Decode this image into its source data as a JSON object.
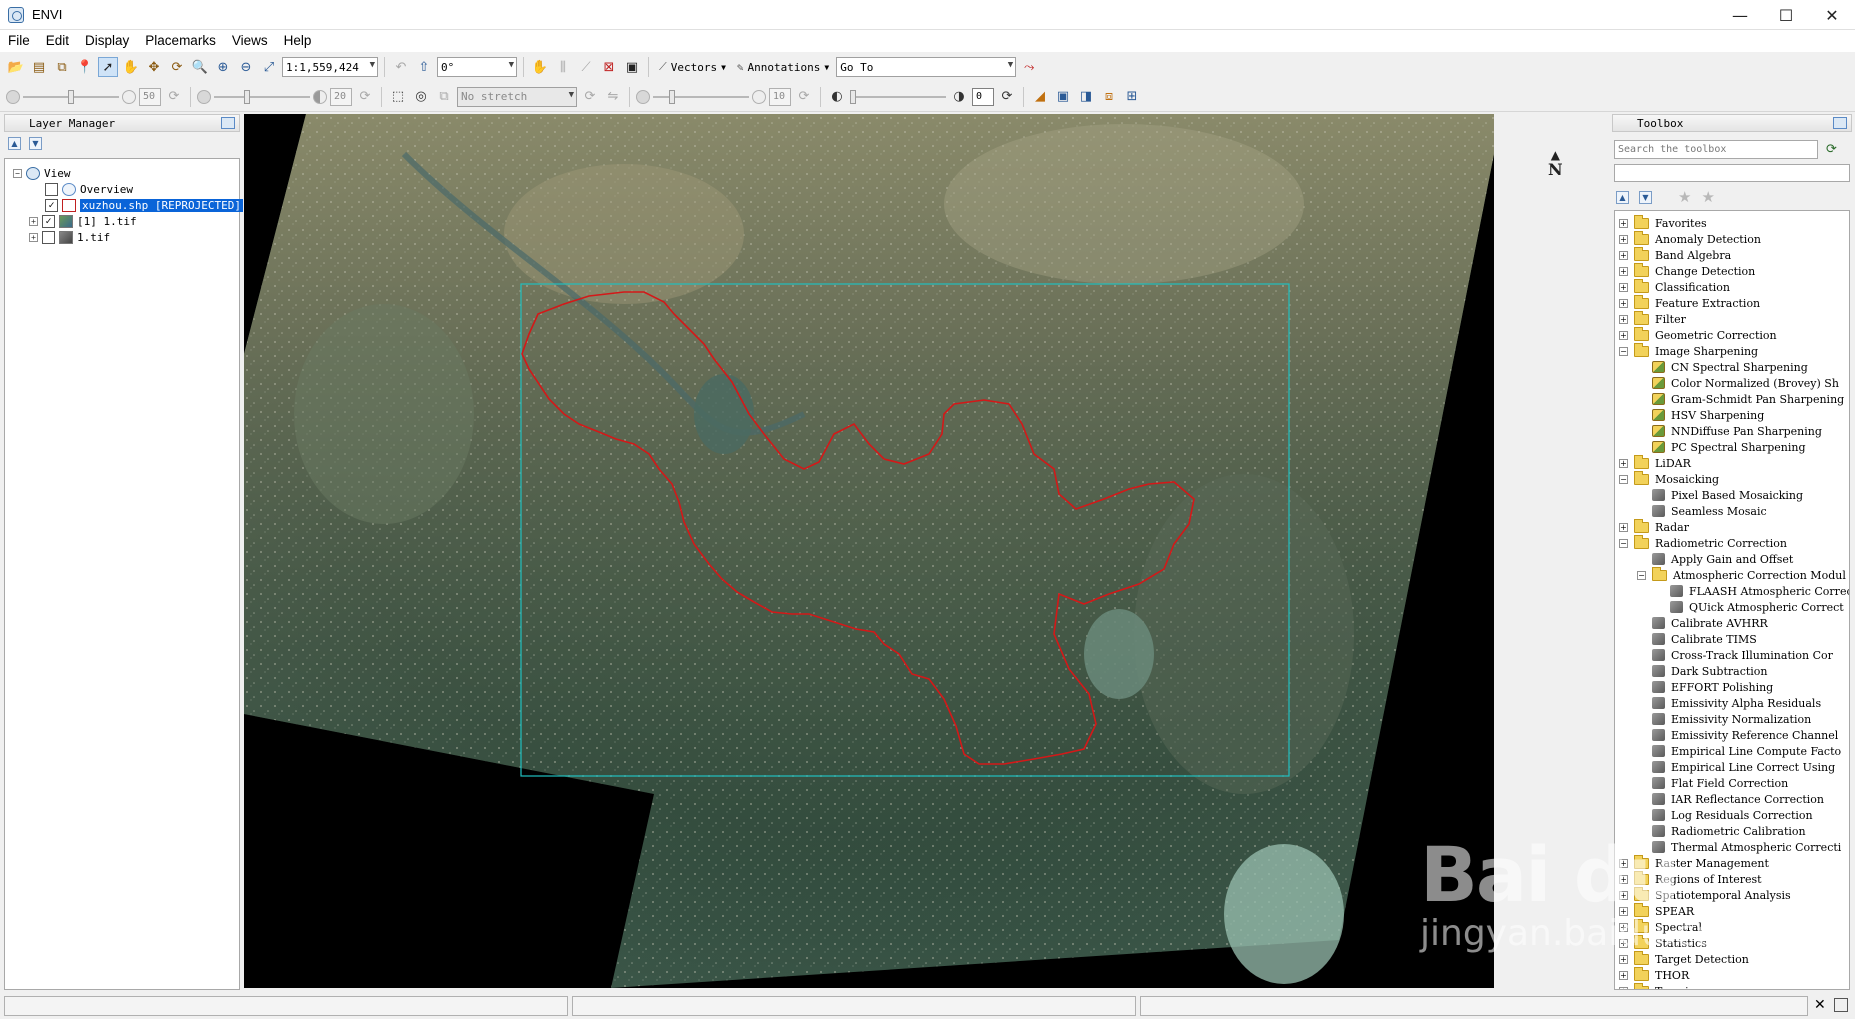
{
  "window": {
    "title": "ENVI",
    "minimize": "—",
    "maximize": "☐",
    "close": "✕"
  },
  "menu": [
    "File",
    "Edit",
    "Display",
    "Placemarks",
    "Views",
    "Help"
  ],
  "toolbar": {
    "scale_value": "1:1,559,424",
    "rotation_value": "0°",
    "vectors_label": "Vectors",
    "annotations_label": "Annotations",
    "goto_value": "Go To",
    "brightness_value": "50",
    "contrast_value": "20",
    "stretch_value": "No stretch",
    "sharpen_value": "10",
    "transparency_value": "0"
  },
  "layer_manager": {
    "title": "Layer Manager",
    "items": [
      {
        "label": "View",
        "checked": null
      },
      {
        "label": "Overview",
        "checked": false
      },
      {
        "label": "xuzhou.shp [REPROJECTED]",
        "checked": true
      },
      {
        "label": "[1] 1.tif",
        "checked": true
      },
      {
        "label": "1.tif",
        "checked": false
      }
    ]
  },
  "map": {
    "north_label": "N"
  },
  "toolbox": {
    "title": "Toolbox",
    "search_placeholder": "Search the toolbox",
    "items": [
      {
        "label": "Favorites",
        "kind": "folder",
        "level": 0
      },
      {
        "label": "Anomaly Detection",
        "kind": "folder",
        "level": 0
      },
      {
        "label": "Band Algebra",
        "kind": "folder",
        "level": 0
      },
      {
        "label": "Change Detection",
        "kind": "folder",
        "level": 0
      },
      {
        "label": "Classification",
        "kind": "folder",
        "level": 0
      },
      {
        "label": "Feature Extraction",
        "kind": "folder",
        "level": 0
      },
      {
        "label": "Filter",
        "kind": "folder",
        "level": 0
      },
      {
        "label": "Geometric Correction",
        "kind": "folder",
        "level": 0
      },
      {
        "label": "Image Sharpening",
        "kind": "folder",
        "level": 0,
        "open": true
      },
      {
        "label": "CN Spectral Sharpening",
        "kind": "img",
        "level": 1
      },
      {
        "label": "Color Normalized (Brovey) Sh",
        "kind": "img",
        "level": 1
      },
      {
        "label": "Gram-Schmidt Pan Sharpening",
        "kind": "img",
        "level": 1
      },
      {
        "label": "HSV Sharpening",
        "kind": "img",
        "level": 1
      },
      {
        "label": "NNDiffuse Pan Sharpening",
        "kind": "img",
        "level": 1
      },
      {
        "label": "PC Spectral Sharpening",
        "kind": "img",
        "level": 1
      },
      {
        "label": "LiDAR",
        "kind": "folder",
        "level": 0
      },
      {
        "label": "Mosaicking",
        "kind": "folder",
        "level": 0,
        "open": true
      },
      {
        "label": "Pixel Based Mosaicking",
        "kind": "tool",
        "level": 1
      },
      {
        "label": "Seamless Mosaic",
        "kind": "tool",
        "level": 1
      },
      {
        "label": "Radar",
        "kind": "folder",
        "level": 0
      },
      {
        "label": "Radiometric Correction",
        "kind": "folder",
        "level": 0,
        "open": true
      },
      {
        "label": "Apply Gain and Offset",
        "kind": "tool",
        "level": 1
      },
      {
        "label": "Atmospheric Correction Modul",
        "kind": "folder",
        "level": 1,
        "open": true
      },
      {
        "label": "FLAASH Atmospheric Correc",
        "kind": "tool",
        "level": 2
      },
      {
        "label": "QUick Atmospheric Correct",
        "kind": "tool",
        "level": 2
      },
      {
        "label": "Calibrate AVHRR",
        "kind": "tool",
        "level": 1
      },
      {
        "label": "Calibrate TIMS",
        "kind": "tool",
        "level": 1
      },
      {
        "label": "Cross-Track Illumination Cor",
        "kind": "tool",
        "level": 1
      },
      {
        "label": "Dark Subtraction",
        "kind": "tool",
        "level": 1
      },
      {
        "label": "EFFORT Polishing",
        "kind": "tool",
        "level": 1
      },
      {
        "label": "Emissivity Alpha Residuals",
        "kind": "tool",
        "level": 1
      },
      {
        "label": "Emissivity Normalization",
        "kind": "tool",
        "level": 1
      },
      {
        "label": "Emissivity Reference Channel",
        "kind": "tool",
        "level": 1
      },
      {
        "label": "Empirical Line Compute Facto",
        "kind": "tool",
        "level": 1
      },
      {
        "label": "Empirical Line Correct Using",
        "kind": "tool",
        "level": 1
      },
      {
        "label": "Flat Field Correction",
        "kind": "tool",
        "level": 1
      },
      {
        "label": "IAR Reflectance Correction",
        "kind": "tool",
        "level": 1
      },
      {
        "label": "Log Residuals Correction",
        "kind": "tool",
        "level": 1
      },
      {
        "label": "Radiometric Calibration",
        "kind": "tool",
        "level": 1
      },
      {
        "label": "Thermal Atmospheric Correcti",
        "kind": "tool",
        "level": 1
      },
      {
        "label": "Raster Management",
        "kind": "folder",
        "level": 0
      },
      {
        "label": "Regions of Interest",
        "kind": "folder",
        "level": 0
      },
      {
        "label": "Spatiotemporal Analysis",
        "kind": "folder",
        "level": 0
      },
      {
        "label": "SPEAR",
        "kind": "folder",
        "level": 0
      },
      {
        "label": "Spectral",
        "kind": "folder",
        "level": 0
      },
      {
        "label": "Statistics",
        "kind": "folder",
        "level": 0
      },
      {
        "label": "Target Detection",
        "kind": "folder",
        "level": 0
      },
      {
        "label": "THOR",
        "kind": "folder",
        "level": 0
      },
      {
        "label": "Terrain",
        "kind": "folder",
        "level": 0
      }
    ]
  },
  "watermark": {
    "brand": "Bai du",
    "site": "jingyan.baidu.com"
  }
}
